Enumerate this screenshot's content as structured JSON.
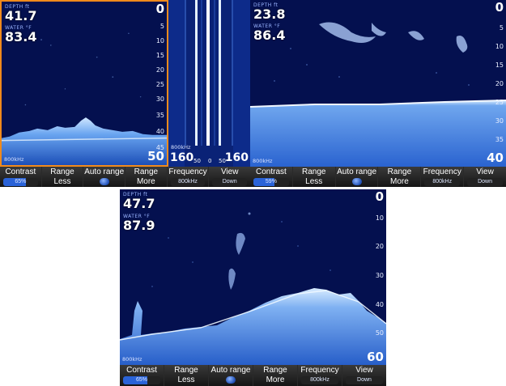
{
  "screens": {
    "top_left_2d": {
      "temp_label": "WATER °F",
      "depth_label": "DEPTH ft",
      "depth_value": "41.7",
      "temp_value": "83.4",
      "scale_top": "0",
      "ticks": [
        "5",
        "10",
        "15",
        "20",
        "25",
        "30",
        "35",
        "40",
        "45"
      ],
      "scale_bottom": "50",
      "frequency_tag": "800kHz"
    },
    "top_middle_split": {
      "frequency_tag": "800kHz",
      "left_range": "160",
      "small_left": "50",
      "center_zero": "0",
      "small_right": "50",
      "right_range": "160"
    },
    "top_right_down": {
      "depth_label": "DEPTH ft",
      "temp_label": "WATER °F",
      "depth_value": "23.8",
      "temp_value": "86.4",
      "scale_top": "0",
      "ticks": [
        "5",
        "10",
        "15",
        "20",
        "25",
        "30",
        "35"
      ],
      "scale_bottom": "40",
      "frequency_tag": "800kHz"
    },
    "bottom_down": {
      "depth_label": "DEPTH ft",
      "temp_label": "WATER °F",
      "depth_value": "47.7",
      "temp_value": "87.9",
      "scale_top": "0",
      "ticks": [
        "10",
        "20",
        "30",
        "40",
        "50"
      ],
      "scale_bottom": "60",
      "frequency_tag": "800kHz"
    }
  },
  "softkeys_top_left": {
    "contrast": {
      "label": "Contrast",
      "value": "65%",
      "level": 0.65
    },
    "range_less": {
      "top": "Range",
      "bottom": "Less"
    },
    "auto_range": {
      "label": "Auto range"
    },
    "range_more": {
      "top": "Range",
      "bottom": "More"
    },
    "frequency": {
      "label": "Frequency",
      "value": "800kHz"
    },
    "view": {
      "label": "View",
      "value": "Down"
    }
  },
  "softkeys_top_right": {
    "contrast": {
      "label": "Contrast",
      "value": "59%",
      "level": 0.59
    },
    "range_less": {
      "top": "Range",
      "bottom": "Less"
    },
    "auto_range": {
      "label": "Auto range"
    },
    "range_more": {
      "top": "Range",
      "bottom": "More"
    },
    "frequency": {
      "label": "Frequency",
      "value": "800kHz"
    },
    "view": {
      "label": "View",
      "value": "Down"
    }
  },
  "softkeys_bottom": {
    "contrast": {
      "label": "Contrast",
      "value": "65%",
      "level": 0.65
    },
    "range_less": {
      "top": "Range",
      "bottom": "Less"
    },
    "auto_range": {
      "label": "Auto range"
    },
    "range_more": {
      "top": "Range",
      "bottom": "More"
    },
    "frequency": {
      "label": "Frequency",
      "value": "800kHz"
    },
    "view": {
      "label": "View",
      "value": "Down"
    }
  },
  "colors": {
    "water": "#04104f",
    "echo_light": "#bfe0ff",
    "echo_mid": "#3f7fe0",
    "active_border": "#f08a1c"
  }
}
